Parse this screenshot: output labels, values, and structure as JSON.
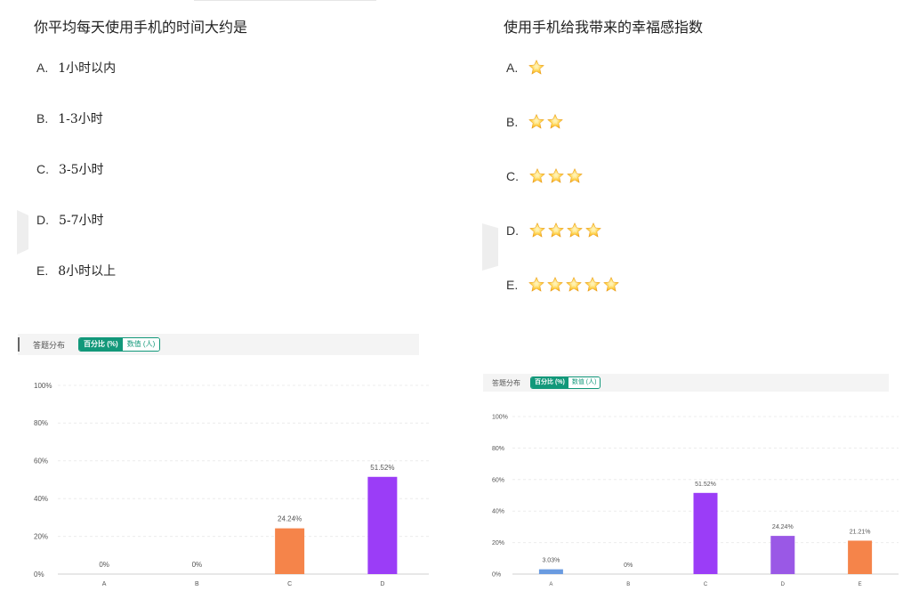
{
  "left_question": {
    "title": "你平均每天使用手机的时间大约是",
    "options": [
      {
        "letter": "A.",
        "text": "1小时以内"
      },
      {
        "letter": "B.",
        "text": "1-3小时"
      },
      {
        "letter": "C.",
        "text": "3-5小时"
      },
      {
        "letter": "D.",
        "text": "5-7小时"
      },
      {
        "letter": "E.",
        "text": "8小时以上"
      }
    ]
  },
  "right_question": {
    "title": "使用手机给我带来的幸福感指数",
    "options": [
      {
        "letter": "A.",
        "stars": 1
      },
      {
        "letter": "B.",
        "stars": 2
      },
      {
        "letter": "C.",
        "stars": 3
      },
      {
        "letter": "D.",
        "stars": 4
      },
      {
        "letter": "E.",
        "stars": 5
      }
    ],
    "star_icon": "star-emoji-icon"
  },
  "stats_toolbar": {
    "label": "答题分布",
    "percent_tab": "百分比 (%)",
    "count_tab": "数值 (人)"
  },
  "colors": {
    "accent": "#12987a",
    "blue": "#6a9be0",
    "orange": "#f5844a",
    "purple": "#9b3df7",
    "lavender": "#9a58e6"
  },
  "chart_data": [
    {
      "type": "bar",
      "categories": [
        "A",
        "B",
        "C",
        "D"
      ],
      "values": [
        0,
        0,
        24.24,
        51.52
      ],
      "value_labels": [
        "0%",
        "0%",
        "24.24%",
        "51.52%"
      ],
      "colors": [
        "#6a9be0",
        "#6a9be0",
        "#f5844a",
        "#9b3df7"
      ],
      "yticks": [
        "0%",
        "20%",
        "40%",
        "60%",
        "80%",
        "100%"
      ],
      "ylim": [
        0,
        100
      ],
      "grid": true
    },
    {
      "type": "bar",
      "categories": [
        "A",
        "B",
        "C",
        "D",
        "E"
      ],
      "values": [
        3.03,
        0,
        51.52,
        24.24,
        21.21
      ],
      "value_labels": [
        "3.03%",
        "0%",
        "51.52%",
        "24.24%",
        "21.21%"
      ],
      "colors": [
        "#6a9be0",
        "#6a9be0",
        "#9b3df7",
        "#9a58e6",
        "#f5844a"
      ],
      "yticks": [
        "0%",
        "20%",
        "40%",
        "60%",
        "80%",
        "100%"
      ],
      "ylim": [
        0,
        100
      ],
      "grid": true
    }
  ]
}
